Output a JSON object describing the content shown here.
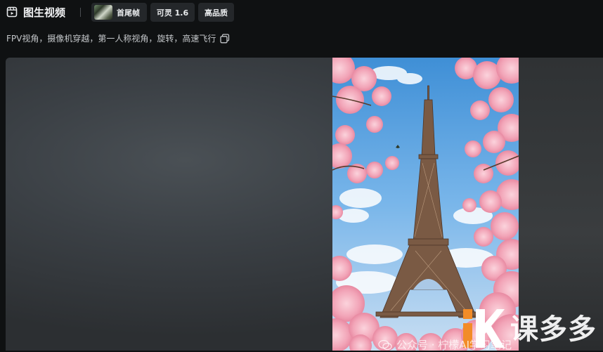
{
  "header": {
    "title": "图生视频",
    "chips": {
      "frame_label": "首尾帧",
      "model_label": "可灵 1.6",
      "quality_label": "高品质"
    }
  },
  "prompt": {
    "text": "FPV视角，摄像机穿越，第一人称视角，旋转，高速飞行"
  },
  "watermark": {
    "brand_text": "课多多",
    "wechat_text": "公众号 · 柠檬AI学习笔记",
    "logo_colors": {
      "orange": "#f28c28",
      "white": "#ffffff"
    }
  },
  "icons": {
    "title": "video-frame-icon",
    "copy": "copy-icon",
    "wechat": "wechat-icon"
  }
}
